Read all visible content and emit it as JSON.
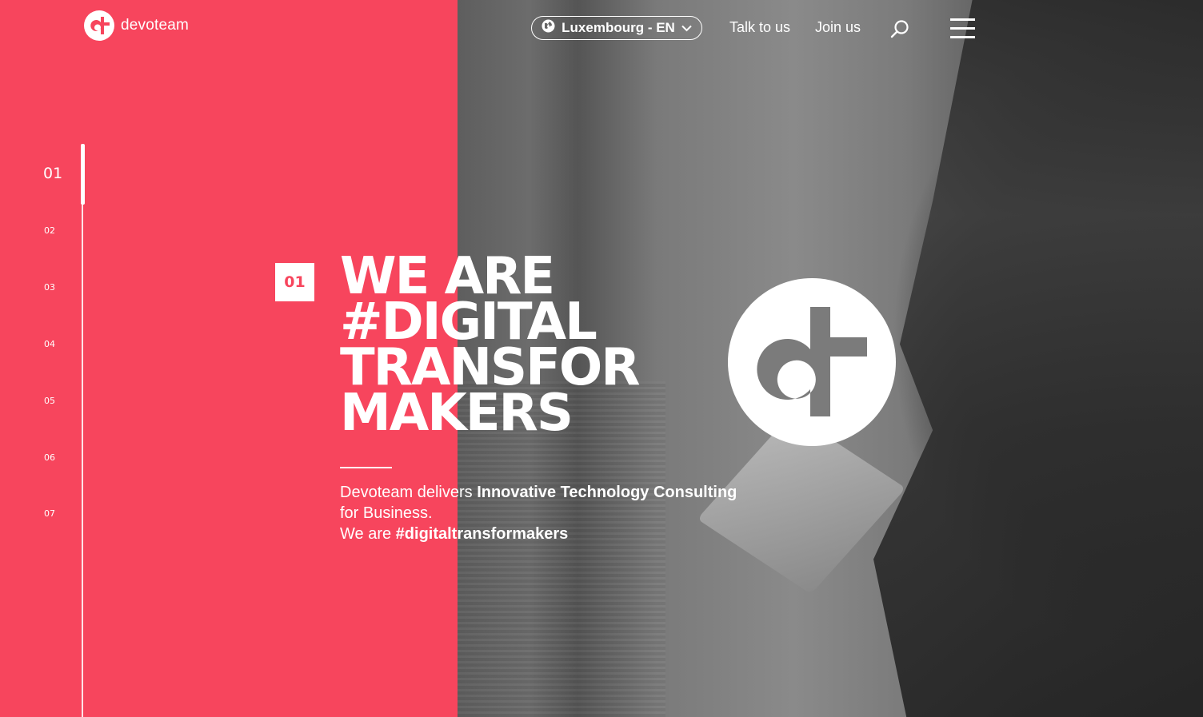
{
  "header": {
    "logo_text": "devoteam",
    "language_selector": "Luxembourg - EN",
    "nav": [
      "Talk to us",
      "Join us"
    ],
    "icons": [
      "globe-icon",
      "chevron-down-icon",
      "search-icon",
      "hamburger-menu-icon"
    ]
  },
  "slides": {
    "numbers": [
      "01",
      "02",
      "03",
      "04",
      "05",
      "06",
      "07"
    ],
    "active": "01"
  },
  "hero": {
    "badge": "01",
    "title_lines": [
      "WE ARE",
      "#DIGITAL",
      "TRANSFOR",
      "MAKERS"
    ],
    "copy": {
      "line1_plain": "Devoteam delivers ",
      "line1_bold": "Innovative Technology Consulting",
      "line2": "for Business.",
      "line3_plain": "We are ",
      "line3_bold": "#digitaltransformakers"
    }
  },
  "colors": {
    "brand_red": "#f7455d",
    "white": "#ffffff"
  }
}
